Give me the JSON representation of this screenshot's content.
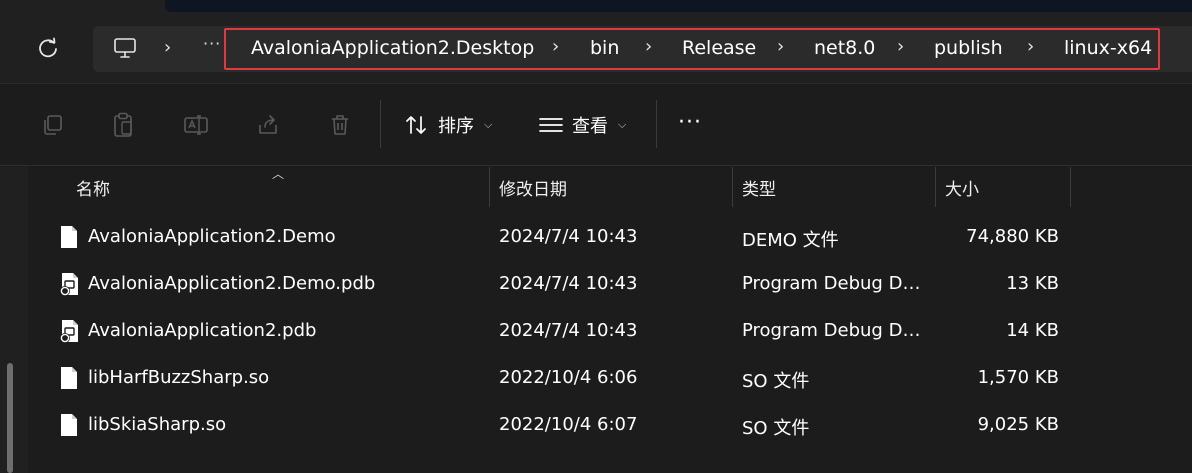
{
  "breadcrumb": {
    "items": [
      "AvaloniaApplication2.Desktop",
      "bin",
      "Release",
      "net8.0",
      "publish",
      "linux-x64"
    ],
    "more": "···"
  },
  "toolbar": {
    "sort_label": "排序",
    "view_label": "查看",
    "more": "···"
  },
  "columns": {
    "name": "名称",
    "date": "修改日期",
    "type": "类型",
    "size": "大小"
  },
  "files": [
    {
      "name": "AvaloniaApplication2.Demo",
      "date": "2024/7/4 10:43",
      "type": "DEMO 文件",
      "size": "74,880 KB",
      "icon": "file-icon"
    },
    {
      "name": "AvaloniaApplication2.Demo.pdb",
      "date": "2024/7/4 10:43",
      "type": "Program Debug Database",
      "size": "13 KB",
      "icon": "debug-file-icon"
    },
    {
      "name": "AvaloniaApplication2.pdb",
      "date": "2024/7/4 10:43",
      "type": "Program Debug Database",
      "size": "14 KB",
      "icon": "debug-file-icon"
    },
    {
      "name": "libHarfBuzzSharp.so",
      "date": "2022/10/4 6:06",
      "type": "SO 文件",
      "size": "1,570 KB",
      "icon": "file-icon"
    },
    {
      "name": "libSkiaSharp.so",
      "date": "2022/10/4 6:07",
      "type": "SO 文件",
      "size": "9,025 KB",
      "icon": "file-icon"
    }
  ],
  "colors": {
    "highlight_border": "#e0393e",
    "background": "#1c1c1c"
  }
}
